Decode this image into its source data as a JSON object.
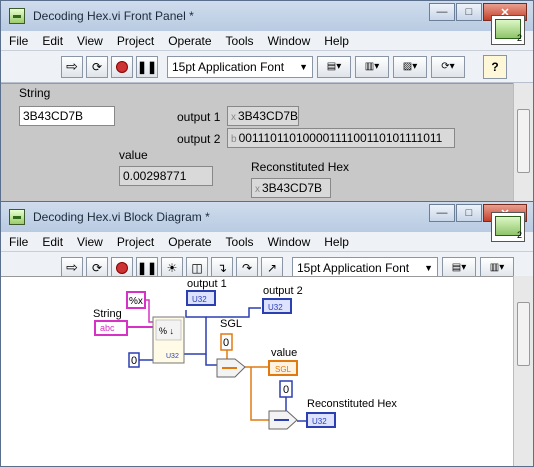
{
  "front_panel": {
    "title": "Decoding Hex.vi Front Panel *",
    "menu": [
      "File",
      "Edit",
      "View",
      "Project",
      "Operate",
      "Tools",
      "Window",
      "Help"
    ],
    "font_selector": "15pt Application Font",
    "connector_number": "2",
    "help_label": "?",
    "controls": {
      "string_label": "String",
      "string_value": "3B43CD7B",
      "output1_label": "output 1",
      "output1_radix": "x",
      "output1_value": "3B43CD7B",
      "output2_label": "output 2",
      "output2_radix": "b",
      "output2_value": "00111011010000111100110101111011",
      "value_label": "value",
      "value_value": "0.00298771",
      "recon_label": "Reconstituted Hex",
      "recon_radix": "x",
      "recon_value": "3B43CD7B"
    }
  },
  "block_diagram": {
    "title": "Decoding Hex.vi Block Diagram *",
    "menu": [
      "File",
      "Edit",
      "View",
      "Project",
      "Operate",
      "Tools",
      "Window",
      "Help"
    ],
    "font_selector": "15pt Application Font",
    "connector_number": "2",
    "nodes": {
      "format_const": "%x",
      "string_label": "String",
      "string_term": "abc",
      "zero_const_1": "0",
      "output1_label": "output 1",
      "output1_term": "U32",
      "output2_label": "output 2",
      "output2_term": "U32",
      "sgl_label": "SGL",
      "zero_const_2": "0",
      "value_label": "value",
      "value_term": "SGL",
      "zero_const_3": "0",
      "recon_label": "Reconstituted Hex",
      "recon_term": "U32",
      "scan_out_type": "U32"
    }
  },
  "colors": {
    "u32_wire": "#2c3fb0",
    "string_wire": "#d633c6",
    "sgl_wire": "#e07a10"
  }
}
